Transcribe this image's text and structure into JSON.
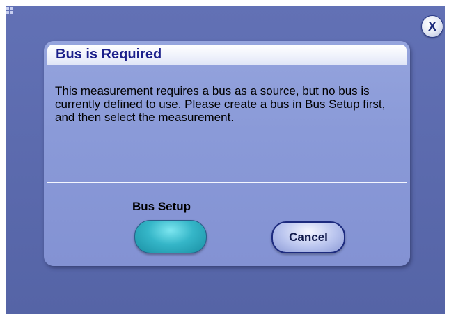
{
  "window": {
    "close_label": "X"
  },
  "dialog": {
    "title": "Bus is Required",
    "message": "This measurement requires a bus as a source, but no bus is currently defined to use. Please create a bus in Bus Setup first, and then select the measurement.",
    "bus_setup_label": "Bus Setup",
    "cancel_label": "Cancel"
  },
  "icons": {
    "close": "close-icon",
    "corner": "window-grip-icon"
  },
  "colors": {
    "background": "#5e6db0",
    "dialog": "#8a9ad8",
    "title_text": "#1b1f8a",
    "bus_setup_button": "#35b6c8",
    "cancel_border": "#1c2a7e"
  }
}
